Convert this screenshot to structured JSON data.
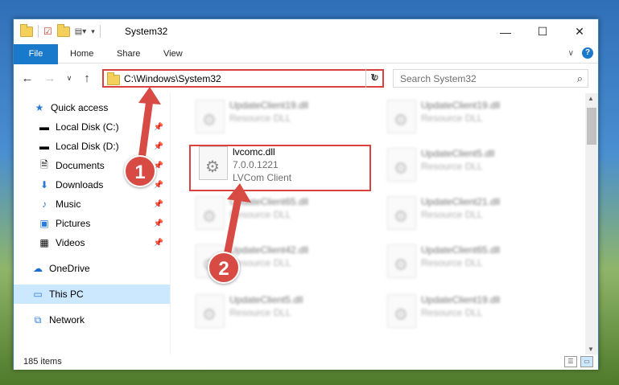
{
  "window": {
    "title": "System32"
  },
  "controls": {
    "minimize": "—",
    "maximize": "☐",
    "close": "✕"
  },
  "ribbon": {
    "tabs": [
      "File",
      "Home",
      "Share",
      "View"
    ],
    "help": "?"
  },
  "address": {
    "path": "C:\\Windows\\System32",
    "search_placeholder": "Search System32"
  },
  "sidebar": {
    "items": [
      {
        "label": "Quick access",
        "icon": "star-icon"
      },
      {
        "label": "Local Disk (C:)",
        "icon": "drive-icon",
        "pinned": true
      },
      {
        "label": "Local Disk (D:)",
        "icon": "drive-icon",
        "pinned": true
      },
      {
        "label": "Documents",
        "icon": "document-icon",
        "pinned": true
      },
      {
        "label": "Downloads",
        "icon": "download-icon",
        "pinned": true
      },
      {
        "label": "Music",
        "icon": "music-icon",
        "pinned": true
      },
      {
        "label": "Pictures",
        "icon": "picture-icon",
        "pinned": true
      },
      {
        "label": "Videos",
        "icon": "video-icon",
        "pinned": true
      },
      {
        "label": "OneDrive",
        "icon": "cloud-icon"
      },
      {
        "label": "This PC",
        "icon": "computer-icon",
        "selected": true
      },
      {
        "label": "Network",
        "icon": "network-icon"
      }
    ]
  },
  "files": [
    {
      "name": "UpdateClient19.dll",
      "type": "Resource DLL",
      "blurred": true
    },
    {
      "name": "UpdateClient19.dll",
      "type": "Resource DLL",
      "blurred": true
    },
    {
      "name": "lvcomc.dll",
      "version": "7.0.0.1221",
      "type": "LVCom Client",
      "highlighted": true
    },
    {
      "name": "UpdateClient5.dll",
      "type": "Resource DLL",
      "blurred": true
    },
    {
      "name": "UpdateClient65.dll",
      "type": "Resource DLL",
      "blurred": true
    },
    {
      "name": "UpdateClient21.dll",
      "type": "Resource DLL",
      "blurred": true
    },
    {
      "name": "UpdateClient42.dll",
      "type": "Resource DLL",
      "blurred": true
    },
    {
      "name": "UpdateClient65.dll",
      "type": "Resource DLL",
      "blurred": true
    },
    {
      "name": "UpdateClient5.dll",
      "type": "Resource DLL",
      "blurred": true
    },
    {
      "name": "UpdateClient19.dll",
      "type": "Resource DLL",
      "blurred": true
    }
  ],
  "status": {
    "item_count": "185 items"
  },
  "annotations": {
    "step1": "1",
    "step2": "2",
    "color": "#d84a44"
  }
}
